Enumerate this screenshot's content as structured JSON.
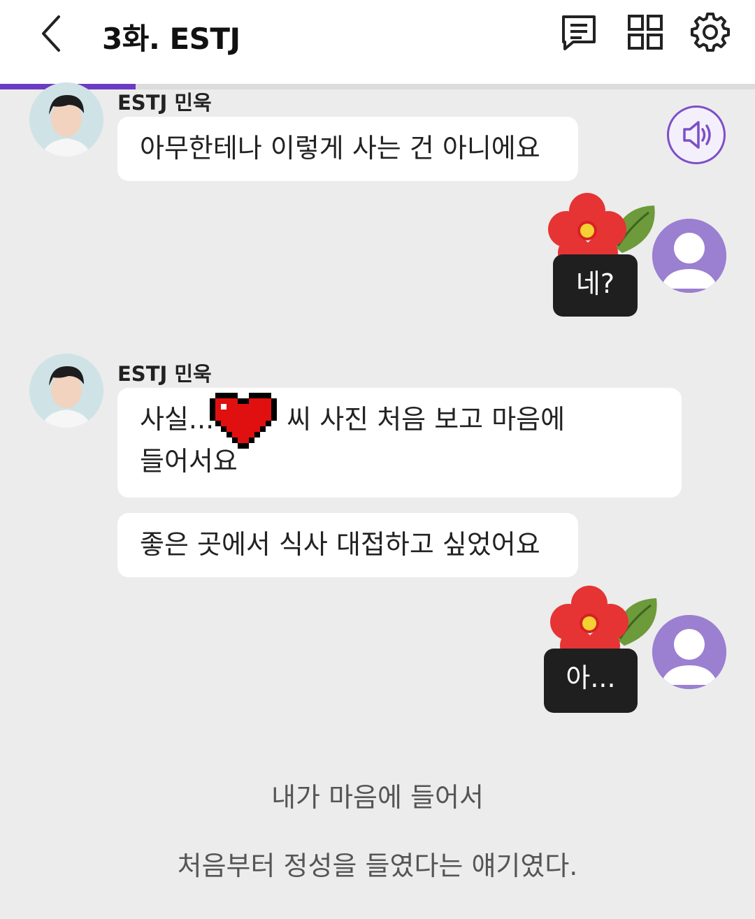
{
  "header": {
    "title": "3화. ESTJ",
    "progress_fraction": 0.18
  },
  "icons": {
    "back": "chevron-left-icon",
    "comments": "comment-list-icon",
    "grid": "grid-icon",
    "settings": "gear-icon",
    "speaker": "speaker-icon"
  },
  "colors": {
    "accent": "#6c3bc3",
    "my_bubble": "#1f1f1f",
    "background": "#ececec"
  },
  "messages": [
    {
      "sender": "ESTJ 민욱",
      "text": "아무한테나 이렇게 사는 건 아니에요"
    },
    {
      "mine": true,
      "text": "네?"
    },
    {
      "sender": "ESTJ 민욱",
      "text_line1": "사실...",
      "text_line1b": "씨 사진 처음 보고 마음에",
      "text_line2": "들어서요"
    },
    {
      "text": "좋은 곳에서 식사 대접하고 싶었어요"
    },
    {
      "mine": true,
      "text": "아..."
    }
  ],
  "narration": [
    "내가 마음에 들어서",
    "처음부터 정성을 들였다는 얘기였다."
  ]
}
